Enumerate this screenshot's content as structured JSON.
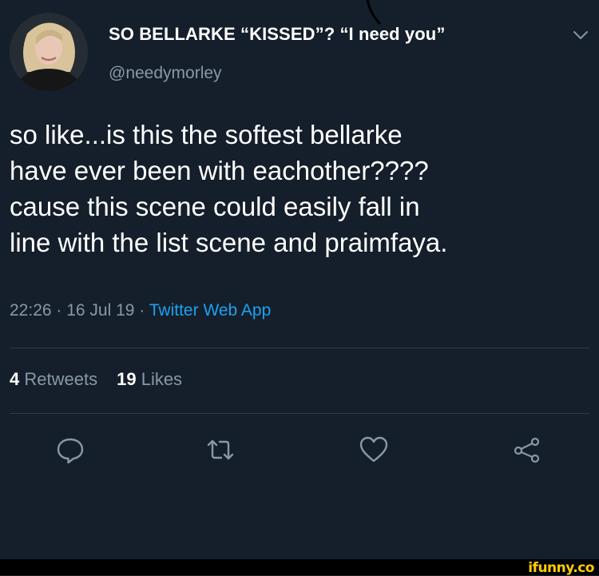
{
  "user": {
    "display_name": "SO BELLARKE “KISSED”? “I need you”",
    "handle": "@needymorley",
    "avatar_icon": "avatar-photo"
  },
  "tweet": {
    "text": "so like...is this the softest bellarke\nhave ever been with eachother????\ncause this scene could easily fall in\nline with the list scene and praimfaya.",
    "time": "22:26",
    "date": "16 Jul 19",
    "sep": " · ",
    "source": "Twitter Web App"
  },
  "stats": {
    "retweets_count": "4",
    "retweets_label": "Retweets",
    "likes_count": "19",
    "likes_label": "Likes"
  },
  "actions": {
    "reply_icon": "reply-icon",
    "retweet_icon": "retweet-icon",
    "like_icon": "heart-icon",
    "share_icon": "share-icon"
  },
  "watermark": "ifunny.co",
  "colors": {
    "background": "#151f2b",
    "muted": "#8899a6",
    "link": "#1da1f2",
    "watermark": "#ffcc00"
  }
}
